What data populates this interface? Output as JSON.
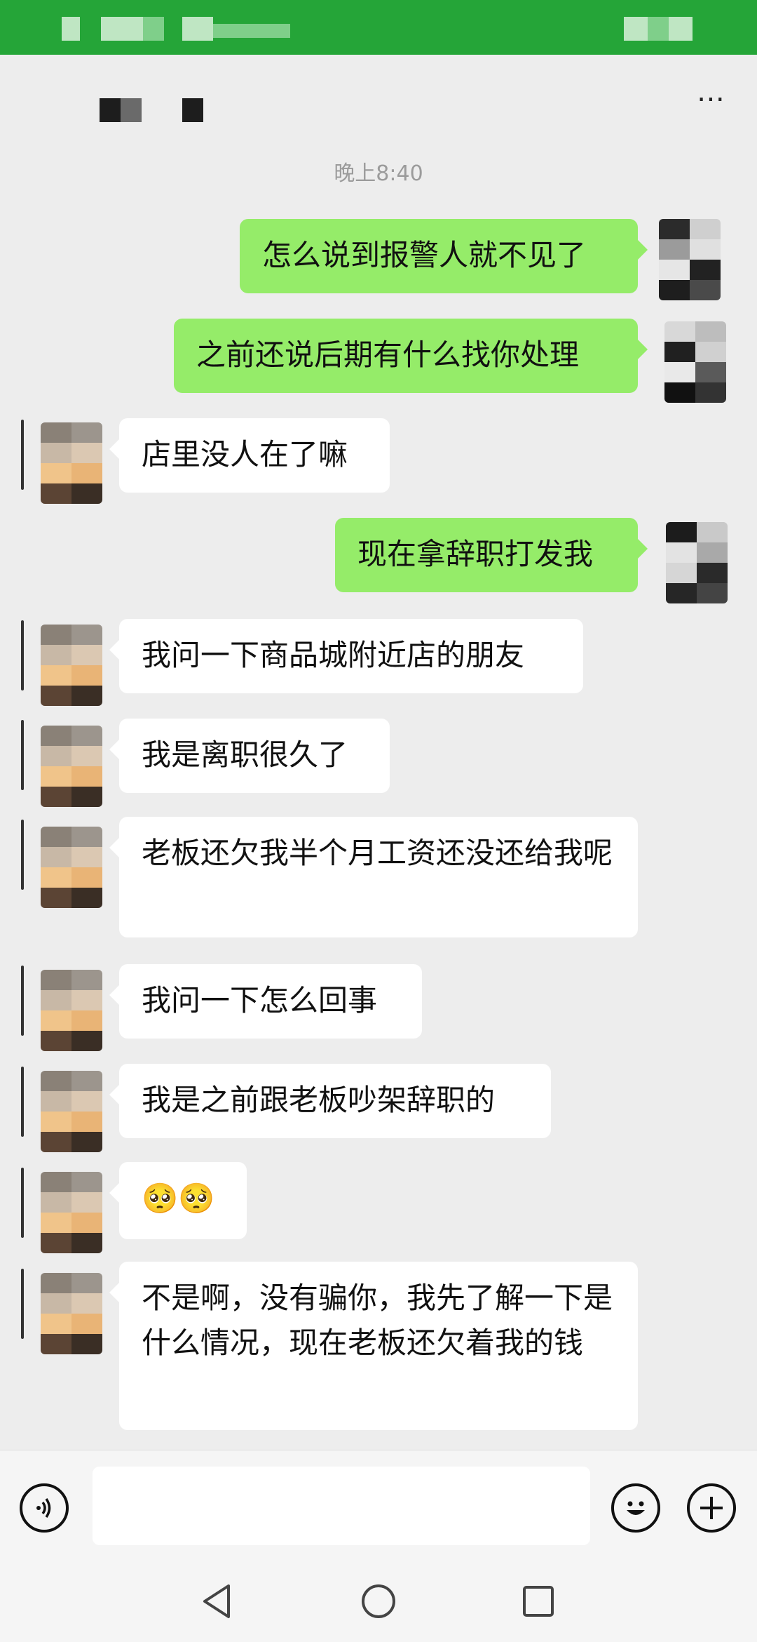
{
  "header": {
    "more_icon": "⋯"
  },
  "chat": {
    "timestamp": "晚上8:40",
    "messages": [
      {
        "side": "me",
        "text": "怎么说到报警人就不见了"
      },
      {
        "side": "me",
        "text": "之前还说后期有什么找你处理"
      },
      {
        "side": "them",
        "text": "店里没人在了嘛"
      },
      {
        "side": "me",
        "text": "现在拿辞职打发我"
      },
      {
        "side": "them",
        "text": "我问一下商品城附近店的朋友"
      },
      {
        "side": "them",
        "text": "我是离职很久了"
      },
      {
        "side": "them",
        "text": "老板还欠我半个月工资还没还给我呢"
      },
      {
        "side": "them",
        "text": "我问一下怎么回事"
      },
      {
        "side": "them",
        "text": "我是之前跟老板吵架辞职的"
      },
      {
        "side": "them",
        "text": "🥺🥺"
      },
      {
        "side": "them",
        "text": "不是啊，没有骗你，我先了解一下是什么情况，现在老板还欠着我的钱"
      }
    ]
  },
  "input": {
    "voice_icon": "voice-icon",
    "emoji_icon": "emoji-icon",
    "plus_icon": "plus-icon"
  },
  "navbar": {
    "back": "back-icon",
    "home": "home-icon",
    "recents": "recents-icon"
  },
  "colors": {
    "my_bubble": "#95ec69",
    "their_bubble": "#ffffff",
    "status_bar": "#25a538",
    "background": "#ededed"
  }
}
